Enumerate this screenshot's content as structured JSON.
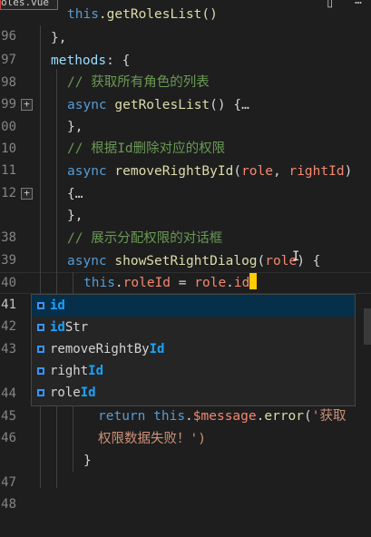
{
  "tab": {
    "label": "oles.vue"
  },
  "lines": [
    {
      "num": "96"
    },
    {
      "num": "97"
    },
    {
      "num": "98"
    },
    {
      "num": "99"
    },
    {
      "num": "00"
    },
    {
      "num": "10"
    },
    {
      "num": "11"
    },
    {
      "num": "12"
    },
    {
      "num": ""
    },
    {
      "num": "38"
    },
    {
      "num": "39"
    },
    {
      "num": "40"
    },
    {
      "num": "41"
    },
    {
      "num": "42"
    },
    {
      "num": "43"
    },
    {
      "num": ""
    },
    {
      "num": "44"
    },
    {
      "num": "45"
    },
    {
      "num": "46"
    },
    {
      "num": ""
    },
    {
      "num": "47"
    },
    {
      "num": "48"
    }
  ],
  "code": {
    "l96_this": "this",
    "l96_rest": ".getRolesList()",
    "l97": "},",
    "l98_id": "methods",
    "l98_rest": ": {",
    "l99": "// 获取所有角色的列表",
    "l100_kw": "async",
    "l100_fn": "getRolesList",
    "l100_rest": "() {",
    "l100_fold": "…",
    "l110": "},",
    "l111": "// 根据Id删除对应的权限",
    "l112_kw": "async",
    "l112_fn": "removeRightById",
    "l112_p1": "role",
    "l112_p2": "rightId",
    "l_fold_open": "{",
    "l_fold_dots": "…",
    "l138": "},",
    "l139": "// 展示分配权限的对话框",
    "l140_kw": "async",
    "l140_fn": "showSetRightDialog",
    "l140_p": "role",
    "l140_rest": ") {",
    "l141_this": "this",
    "l141_prop": "roleId",
    "l141_eq": " = ",
    "l141_obj": "role",
    "l141_dot": ".",
    "l141_id": "id",
    "l146_ret": "return",
    "l146_this": "this",
    "l146_prop": "$message",
    "l146_fn": "error",
    "l146_str": "'获取",
    "l146b_str": "权限数据失败！')",
    "l147": "}"
  },
  "suggestions": [
    {
      "match": "id",
      "rest": "",
      "prefix": ""
    },
    {
      "match": "id",
      "rest": "Str",
      "prefix": ""
    },
    {
      "match": "Id",
      "rest": "",
      "prefix": "removeRightBy"
    },
    {
      "match": "Id",
      "rest": "",
      "prefix": "right"
    },
    {
      "match": "Id",
      "rest": "",
      "prefix": "role"
    }
  ],
  "icons": {
    "suggest": "property-icon",
    "top": "run-icon"
  }
}
